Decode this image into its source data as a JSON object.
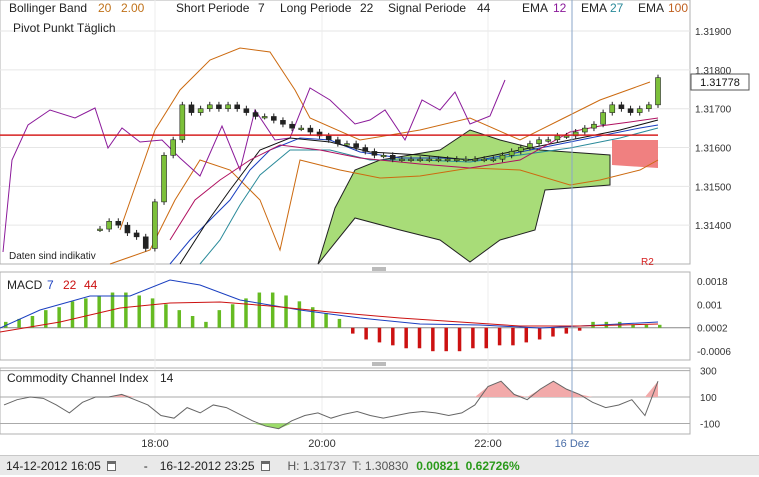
{
  "header": {
    "bollinger": {
      "label": "Bollinger Band",
      "p1": "20",
      "p2": "2.00"
    },
    "short": {
      "label": "Short Periode",
      "value": "7"
    },
    "long": {
      "label": "Long Periode",
      "value": "22"
    },
    "signal": {
      "label": "Signal Periode",
      "value": "44"
    },
    "ema1": {
      "label": "EMA",
      "value": "12"
    },
    "ema2": {
      "label": "EMA",
      "value": "27"
    },
    "ema3": {
      "label": "EMA",
      "value": "100"
    },
    "pivot": "Pivot Punkt  Täglich",
    "disclaimer": "Daten sind indikativ",
    "r2_label": "R2"
  },
  "colors": {
    "bollinger": "#cc6a10",
    "ema12": "#8b1a9a",
    "ema27": "#2a8a9a",
    "ema100": "#c06020",
    "pivot": "#d62020",
    "macd_pos": "#66bb22",
    "macd_neg": "#cc1111",
    "cloud_green": "#a8dc78",
    "cloud_red": "#f08080"
  },
  "main_panel": {
    "price_ticks": [
      "1.31900",
      "1.31800",
      "1.31700",
      "1.31600",
      "1.31500",
      "1.31400"
    ],
    "current_price": "1.31778",
    "ylim": [
      1.313,
      1.3198
    ],
    "pivot_level": 1.31632
  },
  "macd_panel": {
    "label": "MACD",
    "p1": "7",
    "p2": "22",
    "p3": "44",
    "ticks": [
      "0.0018",
      "0.001",
      "0.0002",
      "-0.0006"
    ]
  },
  "cci_panel": {
    "label": "Commodity Channel Index",
    "period": "14",
    "ticks": [
      "300",
      "100",
      "-100"
    ]
  },
  "x_axis": {
    "ticks": [
      "18:00",
      "20:00",
      "22:00",
      "16 Dez"
    ]
  },
  "footer": {
    "from": "14-12-2012 16:05",
    "dash": "-",
    "to": "16-12-2012 23:25",
    "high": "H: 1.31737",
    "low": "T: 1.30830",
    "change": "0.00821",
    "change_pct": "0.62726%"
  },
  "chart_data": {
    "type": "candlestick",
    "price_series_close": [
      1.3139,
      1.3141,
      1.314,
      1.3138,
      1.3137,
      1.3134,
      1.3146,
      1.3158,
      1.3162,
      1.3171,
      1.3169,
      1.317,
      1.3171,
      1.317,
      1.3171,
      1.317,
      1.3169,
      1.3168,
      1.3168,
      1.3167,
      1.3166,
      1.3165,
      1.3165,
      1.3164,
      1.3163,
      1.3162,
      1.3161,
      1.3161,
      1.316,
      1.3159,
      1.3158,
      1.3158,
      1.3157,
      1.3157,
      1.3157,
      1.3157,
      1.3157,
      1.3157,
      1.3157,
      1.3157,
      1.3157,
      1.3157,
      1.3157,
      1.3157,
      1.3158,
      1.3159,
      1.316,
      1.3161,
      1.3162,
      1.3162,
      1.3163,
      1.3163,
      1.3164,
      1.3165,
      1.3166,
      1.3169,
      1.3171,
      1.317,
      1.3169,
      1.317,
      1.3171,
      1.3178
    ],
    "macd_histogram": [
      0.0002,
      0.0003,
      0.0004,
      0.0006,
      0.0007,
      0.0009,
      0.001,
      0.0011,
      0.0012,
      0.0012,
      0.0011,
      0.001,
      0.0008,
      0.0006,
      0.0004,
      0.0002,
      0.0006,
      0.0008,
      0.001,
      0.0012,
      0.0012,
      0.0011,
      0.0009,
      0.0007,
      0.0005,
      0.0003,
      -0.0002,
      -0.0004,
      -0.0005,
      -0.0006,
      -0.0007,
      -0.0007,
      -0.0008,
      -0.0008,
      -0.0008,
      -0.0007,
      -0.0007,
      -0.0006,
      -0.0006,
      -0.0005,
      -0.0004,
      -0.0003,
      -0.0002,
      -0.0001,
      0.0002,
      0.0002,
      0.0002,
      0.0001,
      0.0001,
      0.0001
    ],
    "cci": [
      40,
      80,
      100,
      90,
      40,
      -20,
      60,
      100,
      100,
      120,
      80,
      40,
      -40,
      -60,
      20,
      -20,
      40,
      20,
      -30,
      -80,
      -120,
      -140,
      -80,
      -40,
      -20,
      -60,
      -30,
      -10,
      -40,
      -60,
      -40,
      -20,
      -10,
      -20,
      -40,
      -20,
      40,
      180,
      220,
      120,
      80,
      160,
      220,
      160,
      120,
      60,
      20,
      40,
      80,
      -40,
      220
    ]
  }
}
